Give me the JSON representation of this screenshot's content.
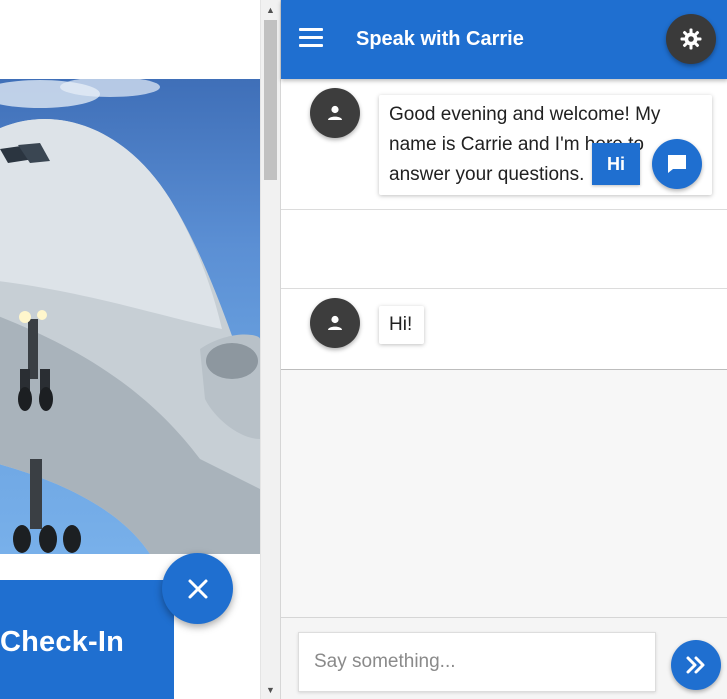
{
  "left_page": {
    "checkin_label": "Check-In",
    "hero_image": "airplane-photo",
    "close_icon": "close-icon"
  },
  "scrollbar": {
    "up_arrow": "▲",
    "down_arrow": "▼"
  },
  "chat": {
    "title": "Speak with Carrie",
    "menu_icon": "hamburger-menu-icon",
    "settings_icon": "settings-icon",
    "messages": [
      {
        "from": "bot",
        "avatar_icon": "person-icon",
        "text": "Good evening and welcome! My name is Carrie and I'm here to answer your questions."
      },
      {
        "from": "user",
        "avatar_icon": "chat-bubble-icon",
        "text": "Hi"
      },
      {
        "from": "bot",
        "avatar_icon": "person-icon",
        "text": "Hi!"
      }
    ],
    "input": {
      "value": "",
      "placeholder": "Say something..."
    },
    "send_icon": "double-chevron-right-icon"
  },
  "colors": {
    "brand_blue": "#1f6fd0",
    "avatar_dark": "#3d3d3d",
    "panel_bg": "#f7f7f7"
  }
}
